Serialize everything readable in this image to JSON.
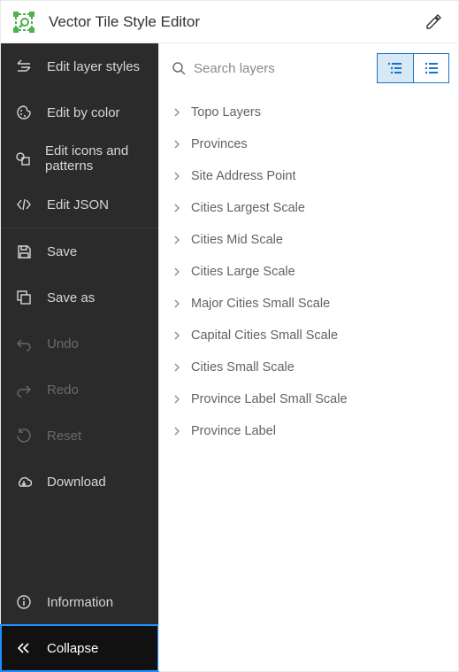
{
  "header": {
    "title": "Vector Tile Style Editor"
  },
  "sidebar": {
    "edit_layer_styles": "Edit layer styles",
    "edit_by_color": "Edit by color",
    "edit_icons_patterns": "Edit icons and patterns",
    "edit_json": "Edit JSON",
    "save": "Save",
    "save_as": "Save as",
    "undo": "Undo",
    "redo": "Redo",
    "reset": "Reset",
    "download": "Download",
    "information": "Information",
    "collapse": "Collapse"
  },
  "panel": {
    "search_placeholder": "Search layers",
    "layers": [
      "Topo Layers",
      "Provinces",
      "Site Address Point",
      "Cities Largest Scale",
      "Cities Mid Scale",
      "Cities Large Scale",
      "Major Cities Small Scale",
      "Capital Cities Small Scale",
      "Cities Small Scale",
      "Province Label Small Scale",
      "Province Label"
    ]
  }
}
